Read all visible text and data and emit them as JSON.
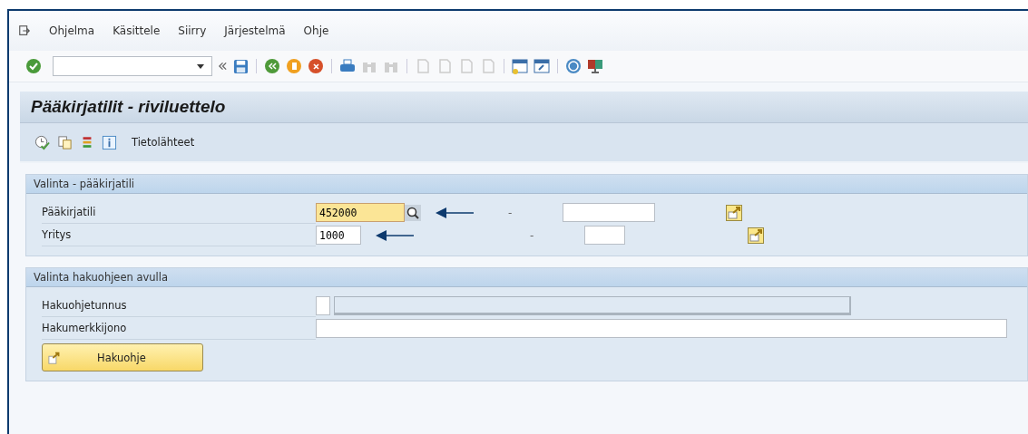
{
  "menu_bar": {
    "items": [
      {
        "label": "Ohjelma"
      },
      {
        "label": "Käsittele"
      },
      {
        "label": "Siirry"
      },
      {
        "label": "Järjestelmä"
      },
      {
        "label": "Ohje"
      }
    ]
  },
  "screen_title": "Pääkirjatilit - riviluettelo",
  "app_toolbar": {
    "button_label": "Tietolähteet"
  },
  "sections": [
    {
      "title": "Valinta - pääkirjatili",
      "rows": [
        {
          "kind": "range",
          "label": "Pääkirjatili",
          "value": "452000",
          "highlighted": true,
          "search_help": true,
          "pointed": true,
          "separator": "-",
          "wide_to_field": true
        },
        {
          "kind": "range",
          "label": "Yritys",
          "value": "1000",
          "highlighted": false,
          "search_help": false,
          "pointed": true,
          "separator": "-",
          "wide_to_field": false
        }
      ]
    },
    {
      "title": "Valinta hakuohjeen avulla",
      "rows": [
        {
          "kind": "split",
          "label": "Hakuohjetunnus"
        },
        {
          "kind": "text",
          "label": "Hakumerkkijono"
        }
      ],
      "button": {
        "label": "Hakuohje"
      }
    }
  ]
}
